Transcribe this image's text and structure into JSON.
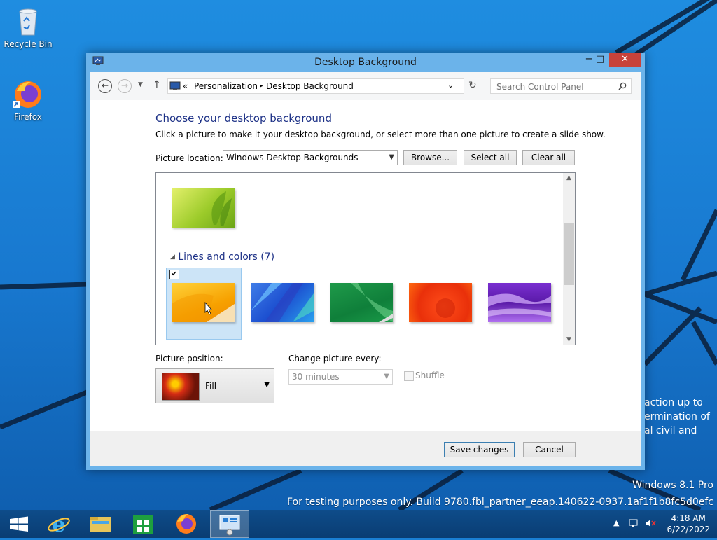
{
  "desktop": {
    "icons": [
      {
        "label": "Recycle Bin",
        "icon": "recycle-bin-icon"
      },
      {
        "label": "Firefox",
        "icon": "firefox-icon"
      }
    ],
    "watermark": {
      "edition": "Windows 8.1 Pro",
      "build": "For testing purposes only. Build 9780.fbl_partner_eeap.140622-0937.1af1f1b8fc5d0efc"
    },
    "background_text": [
      "action up to",
      "ermination of",
      "al civil and"
    ]
  },
  "window": {
    "title": "Desktop Background",
    "controls": {
      "minimize": "−",
      "maximize": "□",
      "close": "✕"
    },
    "address": {
      "prefix": "«",
      "crumbs": [
        "Personalization",
        "Desktop Background"
      ],
      "separator": "▸"
    },
    "search": {
      "placeholder": "Search Control Panel"
    },
    "heading": "Choose your desktop background",
    "description": "Click a picture to make it your desktop background, or select more than one picture to create a slide show.",
    "picture_location": {
      "label": "Picture location:",
      "value": "Windows Desktop Backgrounds",
      "browse": "Browse...",
      "select_all": "Select all",
      "clear_all": "Clear all"
    },
    "gallery": {
      "group": {
        "name": "Lines and colors (7)",
        "collapse_glyph": "◢"
      },
      "selected_index": 0,
      "thumbs": [
        {
          "name": "yellow-orange",
          "checked": true
        },
        {
          "name": "blue-facets",
          "checked": false
        },
        {
          "name": "green-ribbon",
          "checked": false
        },
        {
          "name": "red-orange",
          "checked": false
        },
        {
          "name": "purple-waves",
          "checked": false
        }
      ]
    },
    "picture_position": {
      "label": "Picture position:",
      "value": "Fill"
    },
    "change_picture": {
      "label": "Change picture every:",
      "value": "30 minutes"
    },
    "shuffle": {
      "label": "Shuffle",
      "checked": false
    },
    "buttons": {
      "save": "Save changes",
      "cancel": "Cancel"
    }
  },
  "taskbar": {
    "apps": [
      "start-icon",
      "internet-explorer-icon",
      "file-explorer-icon",
      "store-icon",
      "firefox-icon",
      "control-panel-icon"
    ],
    "clock": {
      "time": "4:18 AM",
      "date": "6/22/2022"
    }
  },
  "colors": {
    "accent": "#6bb3ea",
    "link_blue": "#1e3287",
    "close_red": "#c7423a"
  }
}
